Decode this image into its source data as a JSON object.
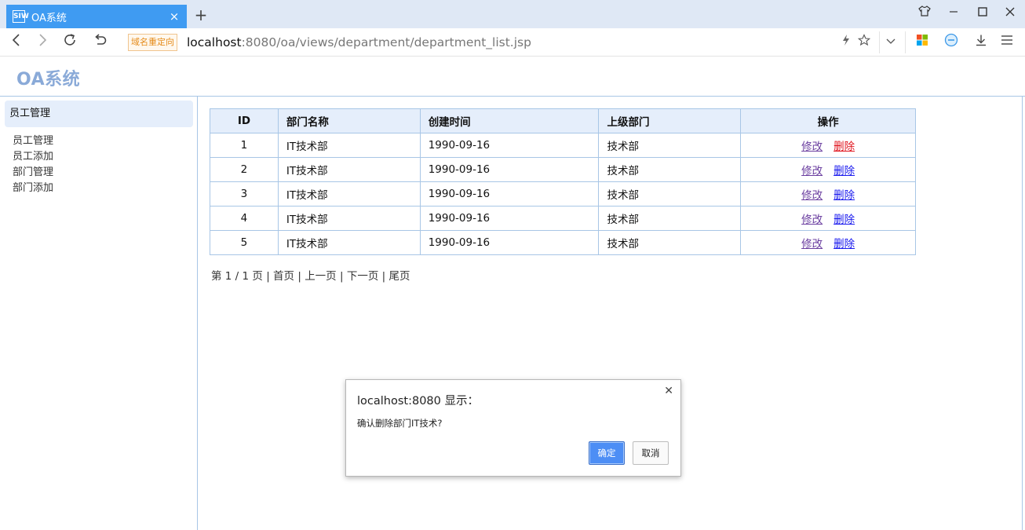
{
  "browser": {
    "tab_title": "OA系统",
    "tab_favicon": "SIW",
    "redirect_badge": "域名重定向",
    "url_host": "localhost",
    "url_rest": ":8080/oa/views/department/department_list.jsp"
  },
  "page": {
    "logo": "OA系统"
  },
  "sidebar": {
    "header": "员工管理",
    "links": [
      {
        "label": "员工管理"
      },
      {
        "label": "员工添加"
      },
      {
        "label": "部门管理"
      },
      {
        "label": "部门添加"
      }
    ]
  },
  "table": {
    "headers": {
      "id": "ID",
      "name": "部门名称",
      "created": "创建时间",
      "parent": "上级部门",
      "ops": "操作"
    },
    "edit_label": "修改",
    "delete_label": "删除",
    "rows": [
      {
        "id": "1",
        "name": "IT技术部",
        "created": "1990-09-16",
        "parent": "技术部"
      },
      {
        "id": "2",
        "name": "IT技术部",
        "created": "1990-09-16",
        "parent": "技术部"
      },
      {
        "id": "3",
        "name": "IT技术部",
        "created": "1990-09-16",
        "parent": "技术部"
      },
      {
        "id": "4",
        "name": "IT技术部",
        "created": "1990-09-16",
        "parent": "技术部"
      },
      {
        "id": "5",
        "name": "IT技术部",
        "created": "1990-09-16",
        "parent": "技术部"
      }
    ]
  },
  "pager": {
    "info": "第 1 / 1 页",
    "first": "首页",
    "prev": "上一页",
    "next": "下一页",
    "last": "尾页"
  },
  "dialog": {
    "title": "localhost:8080 显示：",
    "message": "确认删除部门IT技术?",
    "ok": "确定",
    "cancel": "取消"
  },
  "colors": {
    "tab_active": "#3f9bf2",
    "table_border": "#a8c6e6",
    "header_bg": "#e5eefb",
    "logo": "#8aaad8",
    "delete_active": "#e0141e",
    "ok_button": "#4d8ef5"
  }
}
